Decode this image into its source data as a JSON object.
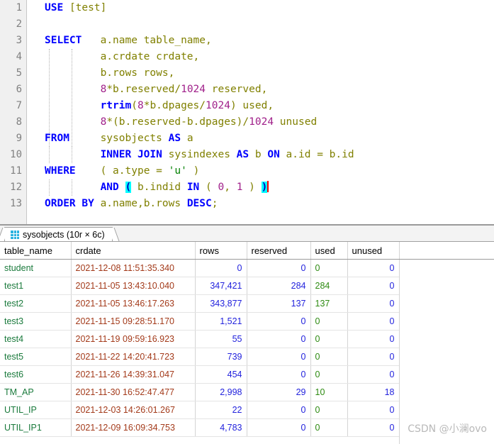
{
  "editor": {
    "line_numbers": [
      "1",
      "2",
      "3",
      "4",
      "5",
      "6",
      "7",
      "8",
      "9",
      "10",
      "11",
      "12",
      "13"
    ],
    "lines": [
      "USE [test]",
      "",
      "SELECT   a.name table_name,",
      "         a.crdate crdate,",
      "         b.rows rows,",
      "         8*b.reserved/1024 reserved,",
      "         rtrim(8*b.dpages/1024) used,",
      "         8*(b.reserved-b.dpages)/1024 unused",
      "FROM     sysobjects AS a",
      "         INNER JOIN sysindexes AS b ON a.id = b.id",
      "WHERE    ( a.type = 'u' )",
      "         AND ( b.indid IN ( 0, 1 ) )",
      "ORDER BY a.name,b.rows DESC;"
    ],
    "colors": {
      "keyword": "#0000ff",
      "identifier": "#808000",
      "number": "#a0208a",
      "string": "#008000",
      "bracket_match_bg": "#00ffff",
      "caret": "#ff0000",
      "gutter_bg": "#f0f0f0",
      "gutter_text": "#808080"
    }
  },
  "results": {
    "tab_label": "sysobjects (10r × 6c)",
    "tab_icon": "grid-icon",
    "columns": [
      "table_name",
      "crdate",
      "rows",
      "reserved",
      "used",
      "unused"
    ],
    "rows": [
      {
        "table_name": "student",
        "crdate": "2021-12-08 11:51:35.340",
        "rows": "0",
        "reserved": "0",
        "used": "0",
        "unused": "0"
      },
      {
        "table_name": "test1",
        "crdate": "2021-11-05 13:43:10.040",
        "rows": "347,421",
        "reserved": "284",
        "used": "284",
        "unused": "0"
      },
      {
        "table_name": "test2",
        "crdate": "2021-11-05 13:46:17.263",
        "rows": "343,877",
        "reserved": "137",
        "used": "137",
        "unused": "0"
      },
      {
        "table_name": "test3",
        "crdate": "2021-11-15 09:28:51.170",
        "rows": "1,521",
        "reserved": "0",
        "used": "0",
        "unused": "0"
      },
      {
        "table_name": "test4",
        "crdate": "2021-11-19 09:59:16.923",
        "rows": "55",
        "reserved": "0",
        "used": "0",
        "unused": "0"
      },
      {
        "table_name": "test5",
        "crdate": "2021-11-22 14:20:41.723",
        "rows": "739",
        "reserved": "0",
        "used": "0",
        "unused": "0"
      },
      {
        "table_name": "test6",
        "crdate": "2021-11-26 14:39:31.047",
        "rows": "454",
        "reserved": "0",
        "used": "0",
        "unused": "0"
      },
      {
        "table_name": "TM_AP",
        "crdate": "2021-11-30 16:52:47.477",
        "rows": "2,998",
        "reserved": "29",
        "used": "10",
        "unused": "18"
      },
      {
        "table_name": "UTIL_IP",
        "crdate": "2021-12-03 14:26:01.267",
        "rows": "22",
        "reserved": "0",
        "used": "0",
        "unused": "0"
      },
      {
        "table_name": "UTIL_IP1",
        "crdate": "2021-12-09 16:09:34.753",
        "rows": "4,783",
        "reserved": "0",
        "used": "0",
        "unused": "0"
      }
    ],
    "colors": {
      "text_string": "#1a7a3c",
      "text_date": "#a33a1a",
      "text_int": "#2222dd",
      "text_varchar": "#2e8b12"
    }
  },
  "watermark": {
    "text": "CSDN @小澜ovo"
  }
}
